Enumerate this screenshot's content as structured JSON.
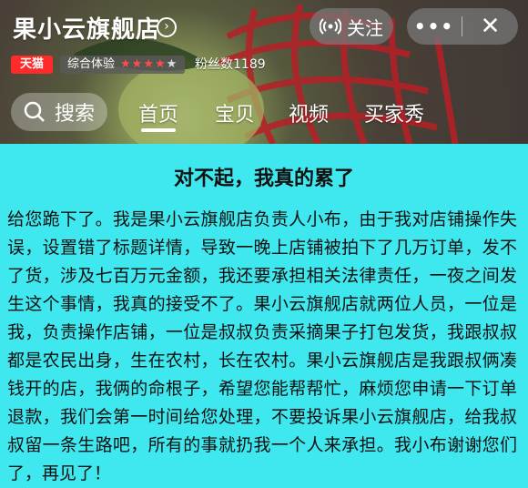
{
  "shop": {
    "name": "果小云旗舰店",
    "follow_label": "关注",
    "more_label": "•••",
    "close_label": "✕",
    "tmall_badge": "天猫",
    "rating_label": "综合体验",
    "stars_filled": "★★★★",
    "stars_empty": "★",
    "fans_label": "粉丝数1189"
  },
  "nav": {
    "search_label": "搜索",
    "tabs": [
      "首页",
      "宝贝",
      "视频",
      "买家秀"
    ],
    "active_tab": "首页"
  },
  "notice": {
    "title": "对不起，我真的累了",
    "body": "给您跪下了。我是果小云旗舰店负责人小布，由于我对店铺操作失误，设置错了标题详情，导致一晚上店铺被拍下了几万订单，发不了货，涉及七百万元金额，我还要承担相关法律责任，一夜之间发生这个事情，我真的接受不了。果小云旗舰店就两位人员，一位是我，负责操作店铺，一位是叔叔负责采摘果子打包发货，我跟叔叔都是农民出身，生在农村，长在农村。果小云旗舰店是我跟叔俩凑钱开的店，我俩的命根子，希望您能帮帮忙，麻烦您申请一下订单退款，我们会第一时间给您处理，不要投诉果小云旗舰店，给我叔叔留一条生路吧，所有的事就扔我一个人来承担。我小布谢谢您们了，再见了！"
  },
  "colors": {
    "content_bg": "#3fe7ee",
    "tmall_red": "#ff2b2b"
  }
}
